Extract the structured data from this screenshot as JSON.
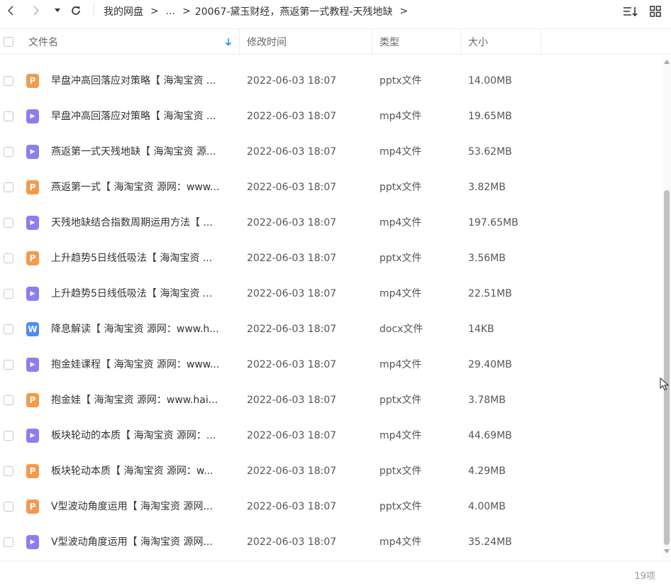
{
  "breadcrumb": {
    "root": "我的网盘",
    "ellipsis": "...",
    "current": "20067-黛玉财经，燕返第一式教程-天残地缺",
    "gt": ">"
  },
  "header": {
    "name": "文件名",
    "time": "修改时间",
    "type": "类型",
    "size": "大小"
  },
  "icon_colors": {
    "pptx": "#f59a4b",
    "mp4": "#8b7ff0",
    "docx": "#4a8df5"
  },
  "files": [
    {
      "name": "早盘冲高回落应对策略【 海淘宝资 ...",
      "time": "2022-06-03 18:07",
      "type": "pptx文件",
      "size": "14.00MB",
      "icon": "pptx",
      "glyph": "P"
    },
    {
      "name": "早盘冲高回落应对策略【 海淘宝资 ...",
      "time": "2022-06-03 18:07",
      "type": "mp4文件",
      "size": "19.65MB",
      "icon": "mp4",
      "glyph": "▶"
    },
    {
      "name": "燕返第一式天残地缺【 海淘宝资 源...",
      "time": "2022-06-03 18:07",
      "type": "mp4文件",
      "size": "53.62MB",
      "icon": "mp4",
      "glyph": "▶"
    },
    {
      "name": "燕返第一式【 海淘宝资 源网：www...",
      "time": "2022-06-03 18:07",
      "type": "pptx文件",
      "size": "3.82MB",
      "icon": "pptx",
      "glyph": "P"
    },
    {
      "name": "天残地缺结合指数周期运用方法【 ...",
      "time": "2022-06-03 18:07",
      "type": "mp4文件",
      "size": "197.65MB",
      "icon": "mp4",
      "glyph": "▶"
    },
    {
      "name": "上升趋势5日线低吸法【 海淘宝资 ...",
      "time": "2022-06-03 18:07",
      "type": "pptx文件",
      "size": "3.56MB",
      "icon": "pptx",
      "glyph": "P"
    },
    {
      "name": "上升趋势5日线低吸法【 海淘宝资 ...",
      "time": "2022-06-03 18:07",
      "type": "mp4文件",
      "size": "22.51MB",
      "icon": "mp4",
      "glyph": "▶"
    },
    {
      "name": "降息解读【 海淘宝资 源网：www.h...",
      "time": "2022-06-03 18:07",
      "type": "docx文件",
      "size": "14KB",
      "icon": "docx",
      "glyph": "W"
    },
    {
      "name": "抱金娃课程【 海淘宝资 源网：www...",
      "time": "2022-06-03 18:07",
      "type": "mp4文件",
      "size": "29.40MB",
      "icon": "mp4",
      "glyph": "▶"
    },
    {
      "name": "抱金娃【 海淘宝资 源网：www.hai...",
      "time": "2022-06-03 18:07",
      "type": "pptx文件",
      "size": "3.78MB",
      "icon": "pptx",
      "glyph": "P"
    },
    {
      "name": "板块轮动的本质【 海淘宝资 源网：...",
      "time": "2022-06-03 18:07",
      "type": "mp4文件",
      "size": "44.69MB",
      "icon": "mp4",
      "glyph": "▶"
    },
    {
      "name": "板块轮动本质【 海淘宝资 源网：w...",
      "time": "2022-06-03 18:07",
      "type": "pptx文件",
      "size": "4.29MB",
      "icon": "pptx",
      "glyph": "P"
    },
    {
      "name": "V型波动角度运用【 海淘宝资 源网...",
      "time": "2022-06-03 18:07",
      "type": "pptx文件",
      "size": "4.00MB",
      "icon": "pptx",
      "glyph": "P"
    },
    {
      "name": "V型波动角度运用【 海淘宝资 源网...",
      "time": "2022-06-03 18:07",
      "type": "mp4文件",
      "size": "35.24MB",
      "icon": "mp4",
      "glyph": "▶"
    }
  ],
  "footer": {
    "count": "19项"
  }
}
